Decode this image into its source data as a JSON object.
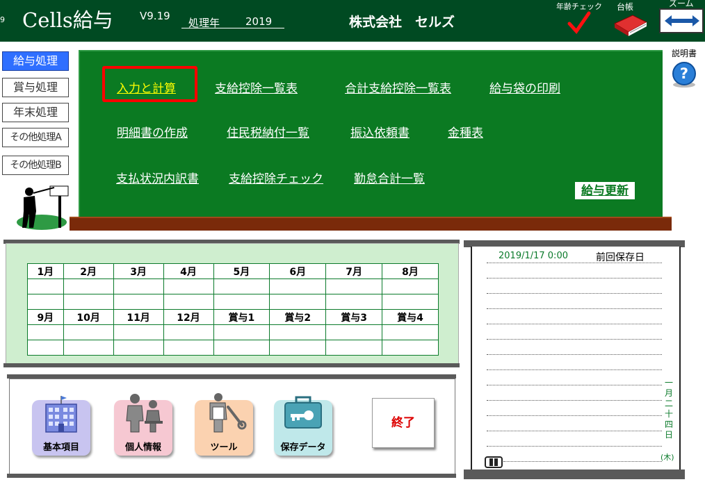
{
  "header": {
    "tiny_left": "9",
    "app_title": "Cells給与",
    "version": "V9.19",
    "year_label": "処理年",
    "year_value": "2019",
    "company": "株式会社　セルズ",
    "age_check_label": "年齢チェック",
    "ledger_label": "台帳",
    "zoom_label": "ズーム",
    "help_label": "説明書"
  },
  "left_menu": [
    {
      "label": "給与処理",
      "active": true
    },
    {
      "label": "賞与処理",
      "active": false
    },
    {
      "label": "年末処理",
      "active": false
    },
    {
      "label": "その他処理A",
      "active": false
    },
    {
      "label": "その他処理B",
      "active": false
    }
  ],
  "board": {
    "row1": [
      "入力と計算",
      "支給控除一覧表",
      "合計支給控除一覧表",
      "給与袋の印刷"
    ],
    "row2": [
      "明細書の作成",
      "住民税納付一覧",
      "振込依頼書",
      "金種表"
    ],
    "row3": [
      "支払状況内訳書",
      "支給控除チェック",
      "勤怠合計一覧"
    ],
    "update_button": "給与更新",
    "highlight_color": "#ff0000"
  },
  "calendar": {
    "row1": [
      "1月",
      "2月",
      "3月",
      "4月",
      "5月",
      "6月",
      "7月",
      "8月"
    ],
    "row2": [
      "9月",
      "10月",
      "11月",
      "12月",
      "賞与1",
      "賞与2",
      "賞与3",
      "賞与4"
    ]
  },
  "tools": {
    "basic": "基本項目",
    "personal": "個人情報",
    "tool": "ツール",
    "save": "保存データ",
    "exit": "終了"
  },
  "note": {
    "saved_at": "2019/1/17 0:00",
    "saved_label": "前回保存日",
    "date_vertical": [
      "一",
      "月",
      "二",
      "十",
      "四",
      "日"
    ],
    "weekday": "(木)"
  }
}
